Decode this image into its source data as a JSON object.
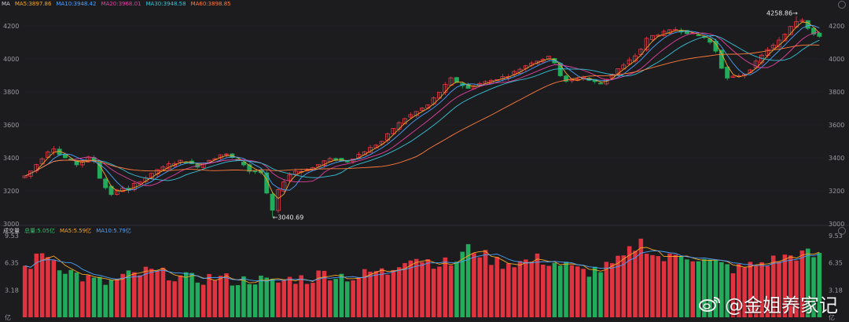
{
  "top_legend": {
    "label": "MA",
    "items": [
      {
        "text": "MA5:3897.86",
        "color": "#f5a623"
      },
      {
        "text": "MA10:3948.42",
        "color": "#4aa3ff"
      },
      {
        "text": "MA20:3968.01",
        "color": "#e040a0"
      },
      {
        "text": "MA30:3948.58",
        "color": "#35c2d6"
      },
      {
        "text": "MA60:3898.85",
        "color": "#ff7a3a"
      }
    ]
  },
  "vol_legend": {
    "label": "成交量",
    "items": [
      {
        "text": "总量:5.05亿",
        "color": "#2fc46b"
      },
      {
        "text": "MA5:5.59亿",
        "color": "#f5a623"
      },
      {
        "text": "MA10:5.79亿",
        "color": "#4aa3ff"
      }
    ]
  },
  "watermark": "@金姐养家记",
  "chart_data": [
    {
      "type": "candlestick",
      "ylim": [
        3000,
        4300
      ],
      "y_ticks": [
        "4200",
        "4000",
        "3800",
        "3600",
        "3400",
        "3200",
        "3000"
      ],
      "annotations": [
        {
          "text": "4258.86"
        },
        {
          "text": "3040.69"
        }
      ],
      "close_path": [
        3290,
        3320,
        3360,
        3400,
        3440,
        3460,
        3420,
        3400,
        3380,
        3360,
        3380,
        3400,
        3380,
        3280,
        3220,
        3180,
        3200,
        3220,
        3200,
        3240,
        3260,
        3280,
        3300,
        3330,
        3340,
        3360,
        3370,
        3380,
        3380,
        3360,
        3350,
        3370,
        3390,
        3400,
        3420,
        3420,
        3400,
        3380,
        3360,
        3320,
        3320,
        3310,
        3180,
        3080,
        3200,
        3260,
        3300,
        3320,
        3320,
        3330,
        3340,
        3360,
        3380,
        3390,
        3390,
        3380,
        3380,
        3400,
        3420,
        3440,
        3460,
        3480,
        3500,
        3540,
        3580,
        3610,
        3640,
        3660,
        3680,
        3700,
        3720,
        3760,
        3800,
        3840,
        3880,
        3860,
        3840,
        3820,
        3840,
        3850,
        3860,
        3870,
        3880,
        3890,
        3900,
        3920,
        3940,
        3960,
        3980,
        3990,
        4000,
        4010,
        3980,
        3900,
        3860,
        3870,
        3880,
        3890,
        3870,
        3860,
        3850,
        3880,
        3910,
        3940,
        3960,
        3990,
        4020,
        4060,
        4120,
        4140,
        4150,
        4160,
        4170,
        4180,
        4170,
        4160,
        4150,
        4140,
        4130,
        4100,
        4050,
        3950,
        3880,
        3890,
        3900,
        3910,
        3940,
        3980,
        4020,
        4060,
        4080,
        4110,
        4150,
        4200,
        4230,
        4240,
        4190,
        4150,
        4130
      ],
      "ma_series": [
        {
          "name": "MA5",
          "color": "#f5a623",
          "lag": 2
        },
        {
          "name": "MA10",
          "color": "#4aa3ff",
          "lag": 4
        },
        {
          "name": "MA20",
          "color": "#e040a0",
          "lag": 8
        },
        {
          "name": "MA30",
          "color": "#35c2d6",
          "lag": 12
        },
        {
          "name": "MA60",
          "color": "#ff7a3a",
          "lag": 26
        }
      ]
    },
    {
      "type": "bar",
      "ylim": [
        0,
        9.53
      ],
      "y_ticks": [
        "9.53",
        "6.35",
        "3.18",
        "亿"
      ],
      "volume_path": [
        5.8,
        6.3,
        7.0,
        7.8,
        6.8,
        6.2,
        5.6,
        5.2,
        4.8,
        4.5,
        4.3,
        4.1,
        4.0,
        4.2,
        4.6,
        4.8,
        4.9,
        5.1,
        5.4,
        5.2,
        5.0,
        5.1,
        4.8,
        4.6,
        4.4,
        4.4,
        4.5,
        4.6,
        4.7,
        4.5,
        4.4,
        4.2,
        4.3,
        4.5,
        4.4,
        4.2,
        4.0,
        4.1,
        4.3,
        4.5,
        4.6,
        4.4,
        4.6,
        5.0,
        5.2,
        5.0,
        4.9,
        4.8,
        4.6,
        4.8,
        5.1,
        5.4,
        5.3,
        5.2,
        6.0,
        6.7,
        7.2,
        7.0,
        6.8,
        6.6,
        6.4,
        6.3,
        6.2,
        6.6,
        7.5,
        8.1,
        7.8,
        7.2,
        6.8,
        6.5,
        6.3,
        6.5,
        6.4,
        6.5,
        6.6,
        6.8,
        6.6,
        6.4,
        6.2,
        6.0,
        5.6,
        5.4,
        5.3,
        5.5,
        5.6,
        5.8,
        6.2,
        6.6,
        7.4,
        8.2,
        8.8,
        8.0,
        7.2,
        6.8,
        6.8,
        7.2,
        7.5,
        7.2,
        7.0,
        6.6,
        6.4,
        6.2,
        6.0,
        5.8,
        5.6,
        5.8,
        6.0,
        6.2,
        6.4,
        6.6,
        6.8,
        7.0,
        7.2,
        7.3,
        7.4,
        7.2,
        7.0
      ],
      "series": [
        {
          "name": "MA5",
          "color": "#f5a623",
          "lag": 3
        },
        {
          "name": "MA10",
          "color": "#4aa3ff",
          "lag": 6
        }
      ]
    }
  ]
}
